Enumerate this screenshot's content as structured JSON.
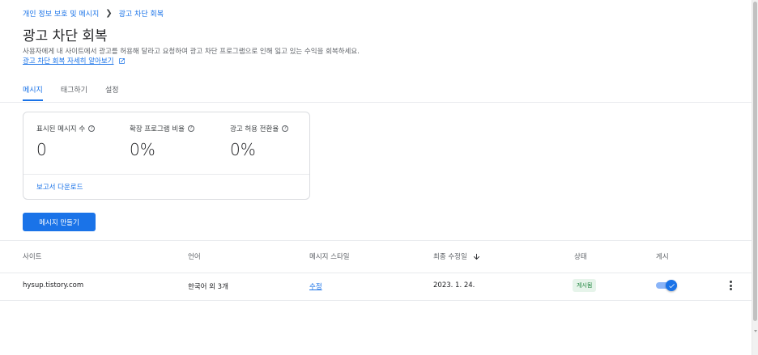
{
  "breadcrumb": {
    "parent": "개인 정보 보호 및 메시지",
    "current": "광고 차단 회복"
  },
  "page": {
    "title": "광고 차단 회복",
    "description": "사용자에게 내 사이트에서 광고를 허용해 달라고 요청하여 광고 차단 프로그램으로 인해 잃고 있는 수익을 회복하세요.",
    "learn_more": "광고 차단 회복 자세히 알아보기"
  },
  "tabs": [
    {
      "label": "메시지",
      "active": true
    },
    {
      "label": "태그하기",
      "active": false
    },
    {
      "label": "설정",
      "active": false
    }
  ],
  "metrics": [
    {
      "label": "표시된 메시지 수",
      "value": "0"
    },
    {
      "label": "확장 프로그램 비율",
      "value": "0%"
    },
    {
      "label": "광고 허용 전환율",
      "value": "0%"
    }
  ],
  "card": {
    "download_label": "보고서 다운로드"
  },
  "create_button": "메시지 만들기",
  "table": {
    "headers": [
      "사이트",
      "언어",
      "메시지 스타일",
      "최종 수정일",
      "상태",
      "게시"
    ],
    "rows": [
      {
        "site": "hysup.tistory.com",
        "language": "한국어 외 3개",
        "style_link": "수정",
        "modified": "2023. 1. 24.",
        "status": "게시됨",
        "published": true
      }
    ]
  },
  "colors": {
    "accent": "#1a73e8",
    "status_bg": "#e6f4ea",
    "status_text": "#188038"
  },
  "icons": {
    "breadcrumb_separator": "chevron-right-icon",
    "external_link": "open-in-new-icon",
    "help": "help-circle-icon",
    "sort": "arrow-down-icon",
    "toggle_check": "check-icon",
    "more": "more-vert-icon"
  }
}
